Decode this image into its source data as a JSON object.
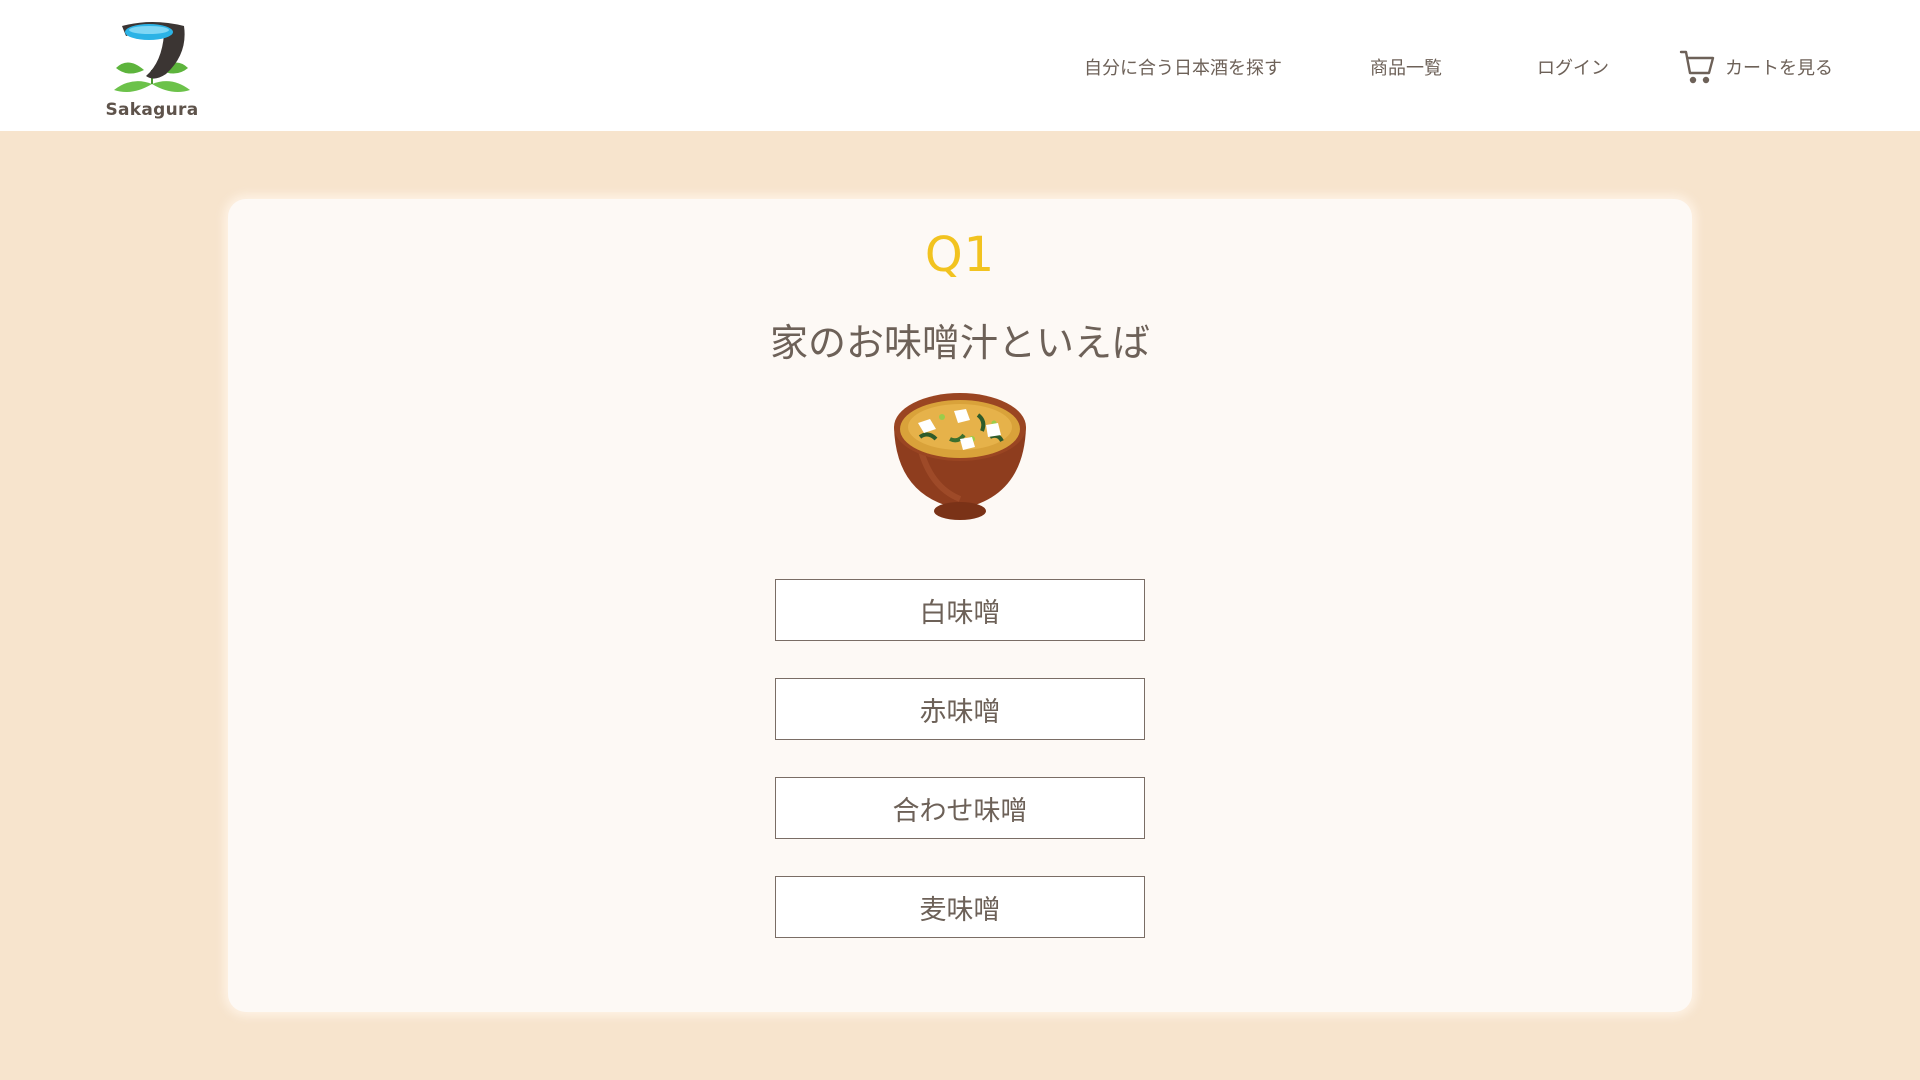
{
  "brand": {
    "name": "Sakagura"
  },
  "nav": {
    "find_sake": "自分に合う日本酒を探す",
    "products": "商品一覧",
    "login": "ログイン",
    "cart": "カートを見る"
  },
  "quiz": {
    "question_number": "Q1",
    "question_text": "家のお味噌汁といえば",
    "image_icon": "miso-soup-bowl",
    "options": [
      "白味噌",
      "赤味噌",
      "合わせ味噌",
      "麦味噌"
    ]
  },
  "colors": {
    "page_background": "#f7e4cd",
    "card_background": "#fdf9f5",
    "question_number": "#f2c31f",
    "text": "#6d6158"
  }
}
